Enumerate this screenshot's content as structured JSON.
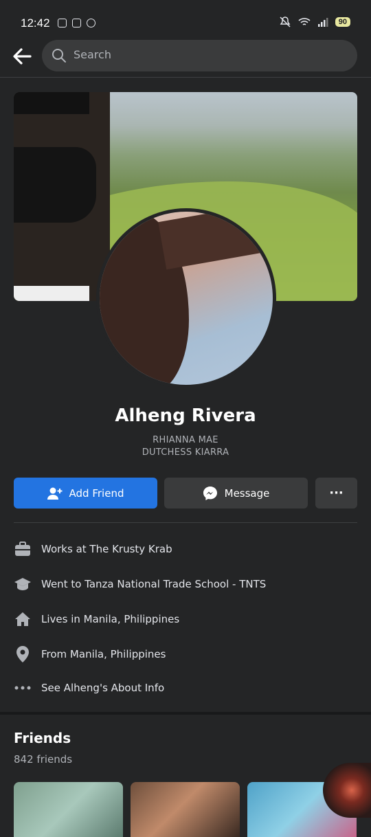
{
  "status_bar": {
    "time": "12:42",
    "battery": "90"
  },
  "search": {
    "placeholder": "Search"
  },
  "profile": {
    "name": "Alheng Rivera",
    "alt_name_1": "RHIANNA MAE",
    "alt_name_2": "DUTCHESS KIARRA"
  },
  "actions": {
    "add_friend": "Add Friend",
    "message": "Message",
    "more": "···"
  },
  "info": {
    "work": "Works at The Krusty Krab",
    "school": "Went to Tanza National Trade School - TNTS",
    "lives": "Lives in Manila, Philippines",
    "from": "From Manila, Philippines",
    "about": "See Alheng's About Info"
  },
  "friends": {
    "title": "Friends",
    "count": "842 friends"
  },
  "colors": {
    "primary": "#2374e1",
    "background": "#242526",
    "surface": "#3a3b3c"
  },
  "icons": [
    "back-arrow-icon",
    "search-icon",
    "add-person-icon",
    "messenger-icon",
    "more-icon",
    "briefcase-icon",
    "graduation-cap-icon",
    "home-icon",
    "location-pin-icon"
  ]
}
